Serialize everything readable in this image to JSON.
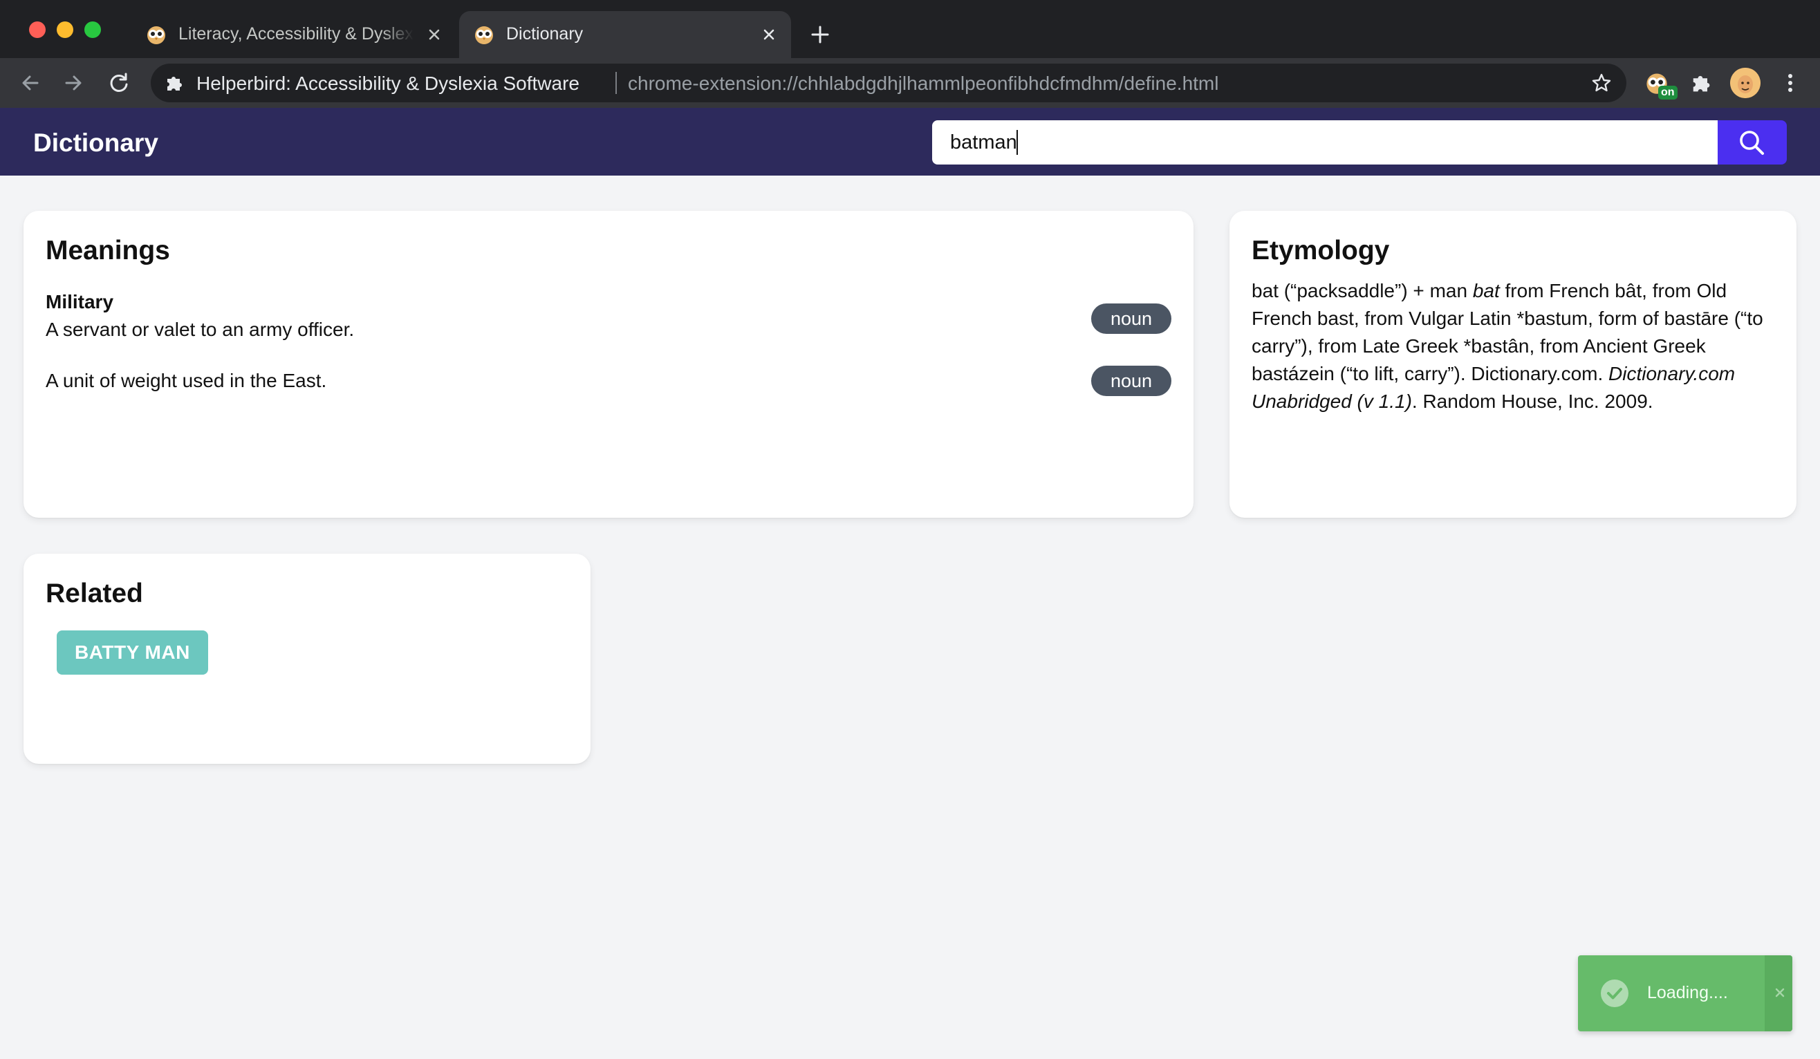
{
  "browser": {
    "tabs": [
      {
        "title": "Literacy, Accessibility & Dyslexia Software",
        "favicon": "helperbird-owl-icon",
        "active": false
      },
      {
        "title": "Dictionary",
        "favicon": "helperbird-owl-icon",
        "active": true
      }
    ],
    "omnibox": {
      "site_name": "Helperbird: Accessibility & Dyslexia Software",
      "url": "chrome-extension://chhlabdgdhjlhammlpeonfibhdcfmdhm/define.html"
    },
    "extension_badge": "on"
  },
  "header": {
    "title": "Dictionary",
    "search_value": "batman"
  },
  "meanings": {
    "title": "Meanings",
    "items": [
      {
        "category": "Military",
        "definition": "A servant or valet to an army officer.",
        "pos": "noun"
      },
      {
        "category": "",
        "definition": "A unit of weight used in the East.",
        "pos": "noun"
      }
    ]
  },
  "etymology": {
    "title": "Etymology",
    "parts": {
      "p1": "bat (“packsaddle”) + man ",
      "p2_italic": "bat",
      "p3": " from French bât, from Old French bast, from Vulgar Latin *bastum, form of bastāre (“to carry”), from Late Greek *bastân, from Ancient Greek bastázein (“to lift, carry”). Dictionary.com. ",
      "p4_italic": "Dictionary.com Unabridged (v 1.1)",
      "p5": ". Random House, Inc. 2009."
    }
  },
  "related": {
    "title": "Related",
    "items": [
      "BATTY MAN"
    ]
  },
  "toast": {
    "text": "Loading....",
    "color": "#66bb6a"
  },
  "colors": {
    "header_bg": "#2d2a5c",
    "search_button": "#4b2ff0",
    "badge_bg": "#4b5563",
    "related_chip": "#6cc7bf"
  }
}
